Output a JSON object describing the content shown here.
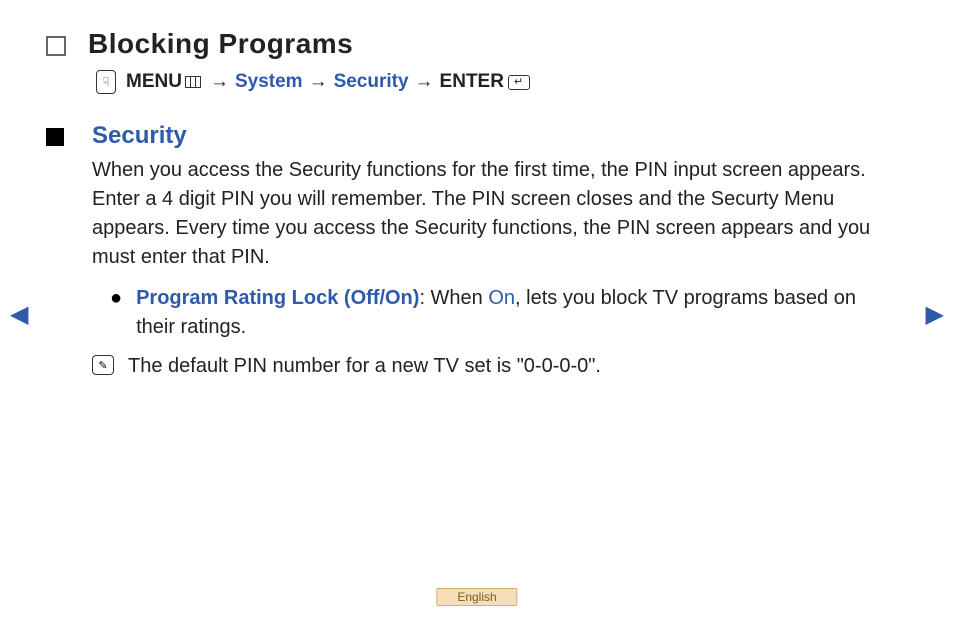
{
  "title": "Blocking Programs",
  "breadcrumb": {
    "menu": "MENU",
    "system": "System",
    "security": "Security",
    "enter": "ENTER",
    "arrow": "→"
  },
  "section": {
    "title": "Security",
    "paragraph": "When you access the Security functions for the first time, the PIN input screen appears. Enter a 4 digit PIN you will remember. The PIN screen closes and the Securty Menu appears. Every time you access the Security functions, the PIN screen appears and you must enter that PIN."
  },
  "bullet": {
    "feature": "Program Rating Lock (Off/On)",
    "after_feature": ": When ",
    "on": "On",
    "tail": ", lets you block TV programs based on their ratings."
  },
  "note": {
    "text": "The default PIN number for a new TV set is \"0-0-0-0\"."
  },
  "language": "English",
  "icons": {
    "remote": "☟",
    "note": "✎"
  }
}
